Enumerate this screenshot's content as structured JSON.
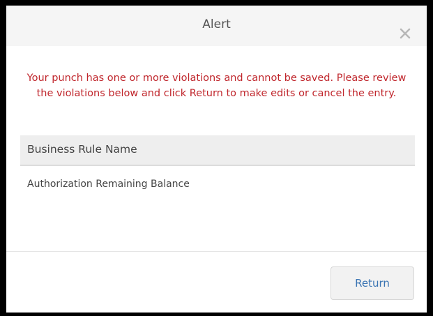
{
  "dialog": {
    "title": "Alert",
    "close_icon": "close-icon",
    "message": "Your punch has one or more violations and cannot be saved. Please review the violations below and click Return to make edits or cancel the entry.",
    "table": {
      "header": "Business Rule Name",
      "rows": [
        "Authorization Remaining Balance"
      ]
    },
    "return_label": "Return"
  },
  "colors": {
    "message_red": "#c0262c",
    "button_text_blue": "#3a74b3",
    "header_bg": "#f5f5f5"
  }
}
